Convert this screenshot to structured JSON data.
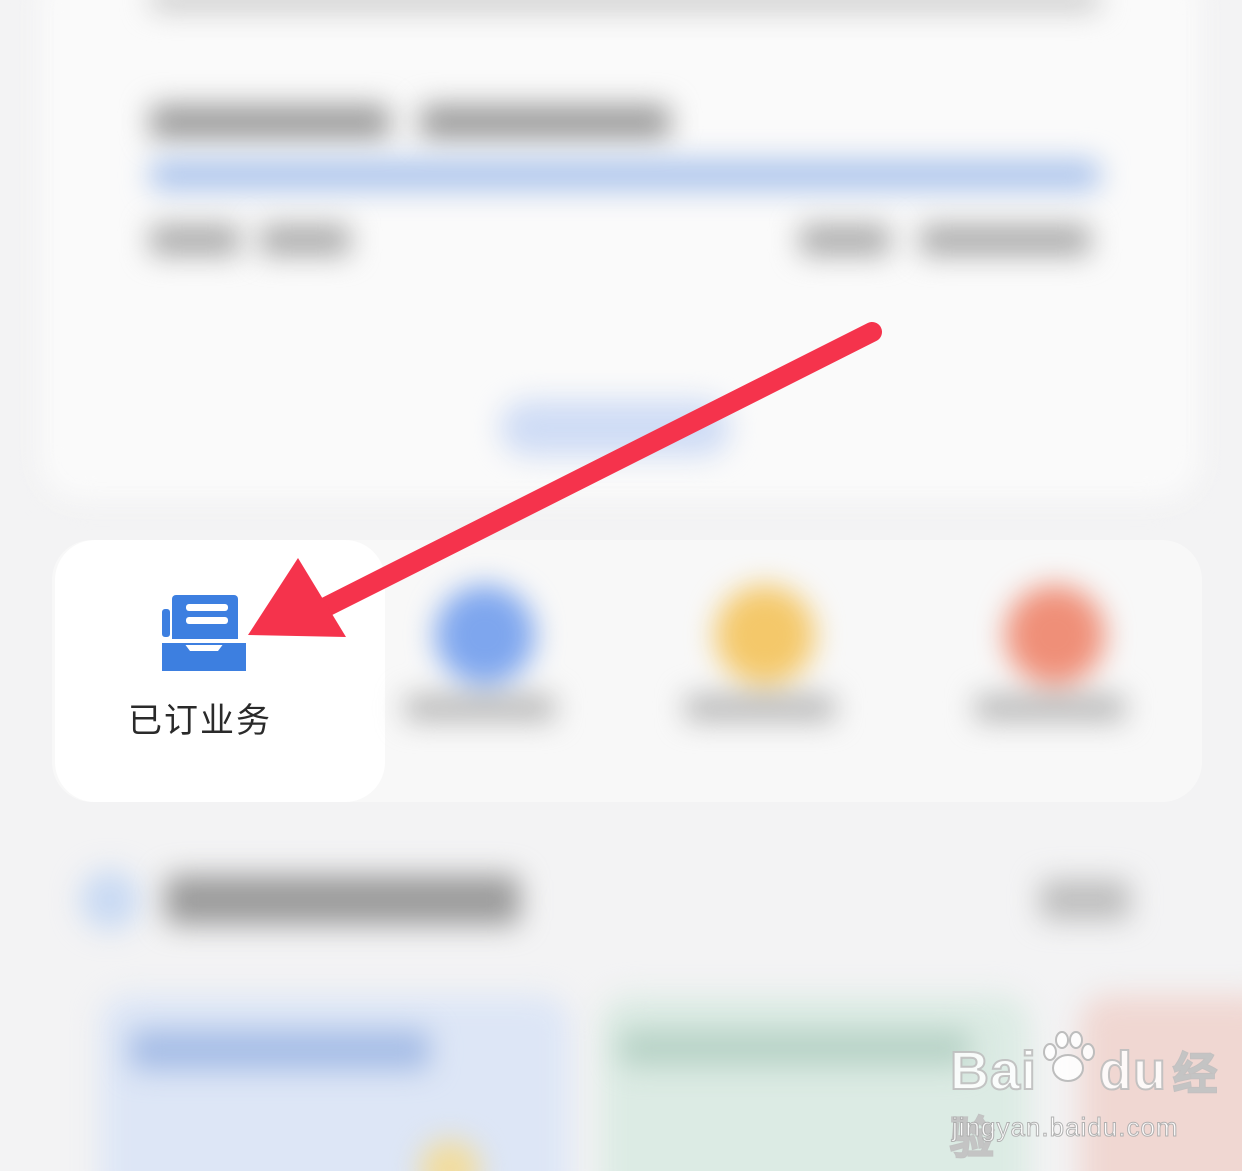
{
  "quick_actions": {
    "subscribed_business": {
      "label": "已订业务",
      "icon": "document-tray-icon"
    }
  },
  "watermark": {
    "brand": "Bai",
    "brand_suffix": "du",
    "brand_cn": "经验",
    "url": "jingyan.baidu.com"
  },
  "colors": {
    "icon_blue": "#3d7fe0",
    "arrow_red": "#f5334c",
    "background": "#f3f3f4"
  }
}
